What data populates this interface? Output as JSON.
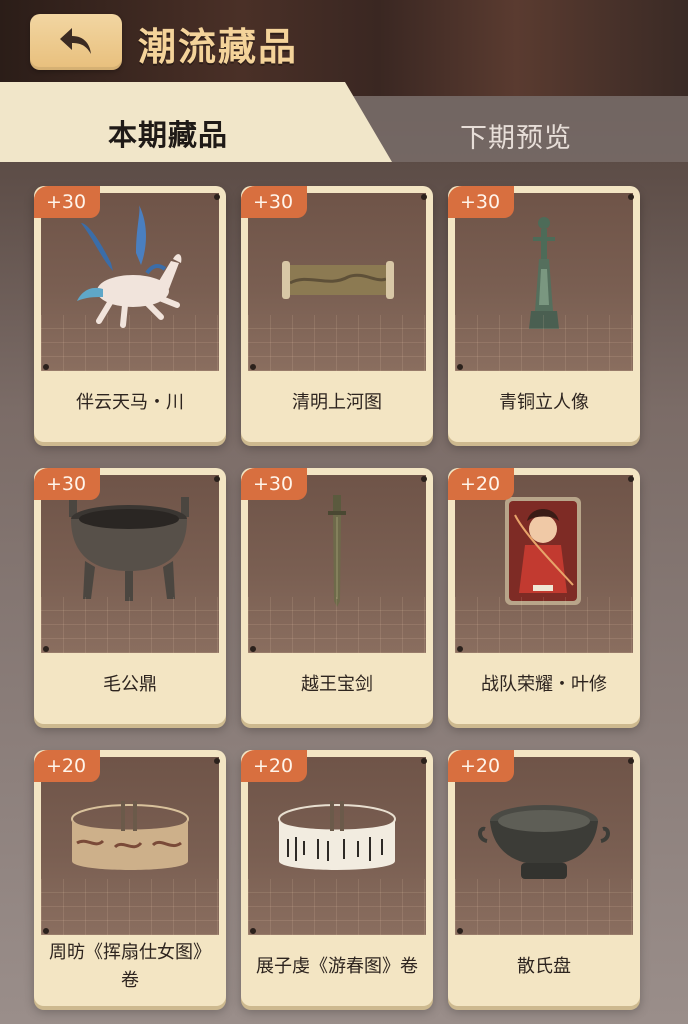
{
  "header": {
    "title": "潮流藏品",
    "back_icon": "back-arrow-icon"
  },
  "tabs": [
    {
      "label": "本期藏品",
      "active": true
    },
    {
      "label": "下期预览",
      "active": false
    }
  ],
  "items": [
    {
      "badge": "+30",
      "name": "伴云天马・川",
      "icon": "winged-horse-icon"
    },
    {
      "badge": "+30",
      "name": "清明上河图",
      "icon": "scroll-painting-icon"
    },
    {
      "badge": "+30",
      "name": "青铜立人像",
      "icon": "bronze-figure-icon"
    },
    {
      "badge": "+30",
      "name": "毛公鼎",
      "icon": "bronze-tripod-icon"
    },
    {
      "badge": "+30",
      "name": "越王宝剑",
      "icon": "bronze-sword-icon"
    },
    {
      "badge": "+20",
      "name": "战队荣耀・叶修",
      "icon": "character-card-icon"
    },
    {
      "badge": "+20",
      "name": "周昉《挥扇仕女图》卷",
      "icon": "painted-scroll-ring-icon"
    },
    {
      "badge": "+20",
      "name": "展子虔《游春图》卷",
      "icon": "calligraphy-scroll-ring-icon"
    },
    {
      "badge": "+20",
      "name": "散氏盘",
      "icon": "bronze-basin-icon"
    }
  ],
  "colors": {
    "badge": "#d86f3f",
    "card": "#f3e5c3",
    "title": "#f4d39a",
    "active_tab": "#f1e6c9"
  }
}
